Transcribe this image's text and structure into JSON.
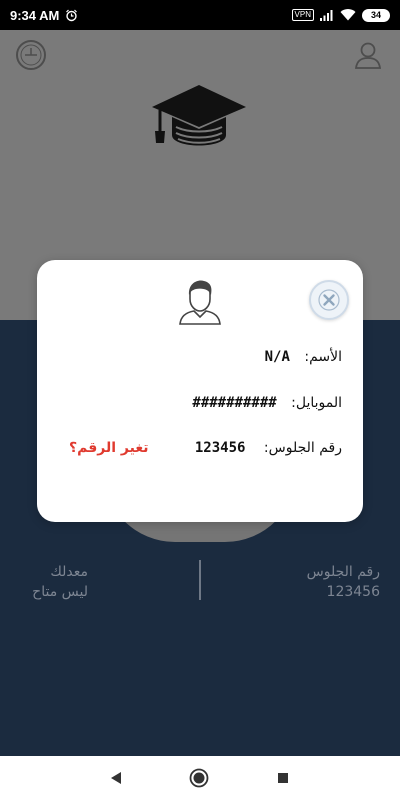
{
  "status_bar": {
    "time": "9:34 AM",
    "vpn": "VPN",
    "battery": "34"
  },
  "icons": {
    "menu": "clock-circle-icon",
    "user": "user-outline-icon",
    "cap": "graduation-cap-icon",
    "avatar": "student-avatar-icon",
    "close": "close-icon"
  },
  "info": {
    "gpa_label": "معدلك",
    "gpa_value": "ليس متاح",
    "seat_label": "رقم الجلوس",
    "seat_value": "123456"
  },
  "modal": {
    "name_label": "الأسم:",
    "name_value": "N/A",
    "mobile_label": "الموبايل:",
    "mobile_value": "##########",
    "seat_label": "رقم الجلوس:",
    "seat_value": "123456",
    "change_link": "تغير الرقم؟"
  },
  "colors": {
    "dim_top": "#7a7a7a",
    "dim_bottom": "#1b2b3f",
    "accent_red": "#e03a2f"
  }
}
